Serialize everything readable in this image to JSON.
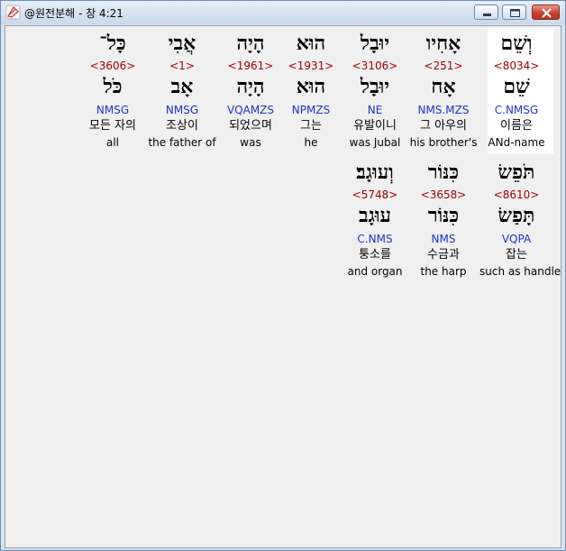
{
  "window": {
    "title": "@원전분해 - 창 4:21",
    "icons": {
      "app": "bible-app-icon",
      "minimize": "minimize-icon",
      "maximize": "maximize-icon",
      "close": "close-icon"
    },
    "colors": {
      "strong": "#a00000",
      "morph": "#1a34c8",
      "highlight": "#ffffff"
    }
  },
  "rows": [
    {
      "words": [
        {
          "hebrew": "וְשֵׁם",
          "strong": "<8034>",
          "lemma": "שֵׁם",
          "morph": "C.NMSG",
          "korean": "이름은",
          "english": "ANd-name",
          "selected": true
        },
        {
          "hebrew": "אָחִיו",
          "strong": "<251>",
          "lemma": "אָח",
          "morph": "NMS.MZS",
          "korean": "그 아우의",
          "english": "his brother's",
          "selected": false
        },
        {
          "hebrew": "יוּבָל",
          "strong": "<3106>",
          "lemma": "יוּבָל",
          "morph": "NE",
          "korean": "유발이니",
          "english": "was Jubal",
          "selected": false
        },
        {
          "hebrew": "הוּא",
          "strong": "<1931>",
          "lemma": "הוּא",
          "morph": "NPMZS",
          "korean": "그는",
          "english": "he",
          "selected": false
        },
        {
          "hebrew": "הָיָה",
          "strong": "<1961>",
          "lemma": "הָיָה",
          "morph": "VQAMZS",
          "korean": "되었으며",
          "english": "was",
          "selected": false
        },
        {
          "hebrew": "אֲבִי",
          "strong": "<1>",
          "lemma": "אָב",
          "morph": "NMSG",
          "korean": "조상이",
          "english": "the father of",
          "selected": false
        },
        {
          "hebrew": "כָּל־",
          "strong": "<3606>",
          "lemma": "כֹּל",
          "morph": "NMSG",
          "korean": "모든 자의",
          "english": "all",
          "selected": false
        }
      ]
    },
    {
      "words": [
        {
          "hebrew": "תֹּפֵשׂ",
          "strong": "<8610>",
          "lemma": "תָּפַשׂ",
          "morph": "VQPA",
          "korean": "잡는",
          "english": "such as handle",
          "selected": false
        },
        {
          "hebrew": "כִּנּוֹר",
          "strong": "<3658>",
          "lemma": "כִּנּוֹר",
          "morph": "NMS",
          "korean": "수금과",
          "english": "the harp",
          "selected": false
        },
        {
          "hebrew": "וְעוּגָב׃",
          "strong": "<5748>",
          "lemma": "עוּגָב",
          "morph": "C.NMS",
          "korean": "퉁소를",
          "english": "and organ",
          "selected": false
        }
      ]
    }
  ]
}
